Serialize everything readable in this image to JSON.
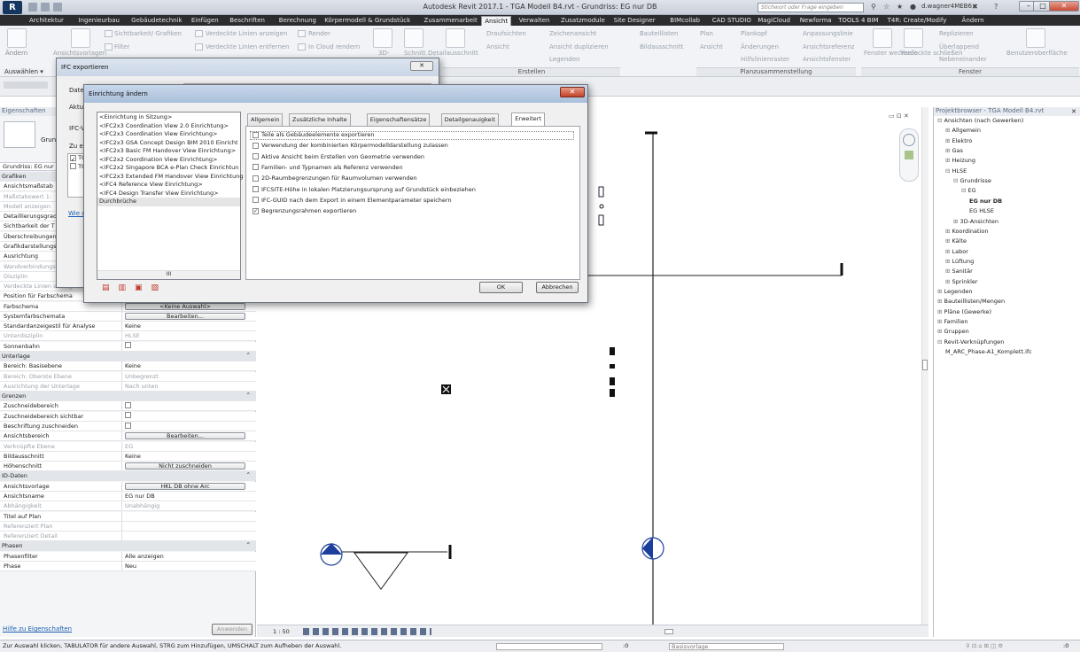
{
  "window": {
    "title": "Autodesk Revit 2017.1 -   TGA Modell B4.rvt - Grundriss: EG nur DB",
    "search_placeholder": "Stichwort oder Frage eingeben",
    "user": "d.wagner4MEB6"
  },
  "menu": {
    "tabs": [
      "Architektur",
      "Ingenieurbau",
      "Gebäudetechnik",
      "Einfügen",
      "Beschriften",
      "Berechnung",
      "Körpermodell & Grundstück",
      "Zusammenarbeit",
      "Ansicht",
      "Verwalten",
      "Zusatzmodule",
      "Site Designer",
      "BIMcollab",
      "CAD STUDIO",
      "MagiCloud",
      "Newforma",
      "TOOLS 4 BIM",
      "T4R: Create/Modify",
      "Ändern"
    ],
    "active": "Ansicht"
  },
  "ribbon": {
    "items": [
      "Sichtbarkeit/ Grafiken",
      "Verdeckte Linien anzeigen",
      "Render",
      "Draufsichten",
      "Zeichenansicht",
      "Bauteillisten",
      "Plan",
      "Plankopf",
      "Anpassungslinie",
      "Filter",
      "Verdeckte Linien entfernen",
      "In Cloud  rendern",
      "Ansicht",
      "Ansicht duplizieren",
      "Bildausschnitt",
      "Ansicht",
      "Änderungen",
      "Ansichtsreferenz",
      "Replizieren",
      "Überlappend",
      "Benutzeroberfläche",
      "Legenden",
      "Hilfslinienraster",
      "Ansichtsfenster",
      "Fenster wechseln",
      "Verdeckte schließen",
      "Nebeneinander",
      "Ändern",
      "Ansichtsvorlagen",
      "3D-",
      "Schnitt",
      "Detailausschnitt"
    ],
    "panels": [
      "Erstellen",
      "Planzusammenstellung",
      "Fenster"
    ]
  },
  "optionsbar": {
    "select_label": "Auswählen ▾"
  },
  "properties": {
    "header": "Eigenschaften",
    "type_label": "Grundriss",
    "instance_label": "Grundriss: EG nur",
    "rows": [
      {
        "kind": "group",
        "label": "Grafiken"
      },
      {
        "label": "Ansichtsmaßstab",
        "value": ""
      },
      {
        "label": "Maßstabswert 1:",
        "value": "",
        "grey": true
      },
      {
        "label": "Modell anzeigen",
        "value": "",
        "grey": true
      },
      {
        "label": "Detaillierungsgrad",
        "value": ""
      },
      {
        "label": "Sichtbarkeit der T",
        "value": ""
      },
      {
        "label": "Überschreibungen",
        "value": ""
      },
      {
        "label": "Grafikdarstellungsoptionen",
        "value": ""
      },
      {
        "label": "Ausrichtung",
        "value": ""
      },
      {
        "label": "Wandverbindungsanzeige",
        "value": "",
        "grey": true
      },
      {
        "label": "Disziplin",
        "value": "",
        "grey": true
      },
      {
        "label": "Verdeckte Linien anzeigen",
        "value": "",
        "grey": true
      },
      {
        "label": "Position für Farbschema",
        "value": ""
      },
      {
        "label": "Farbschema",
        "button": "<Keine Auswahl>"
      },
      {
        "label": "Systemfarbschemata",
        "button": "Bearbeiten..."
      },
      {
        "label": "Standardanzeigestil für Analyse",
        "value": "Keine"
      },
      {
        "label": "Unterdisziplin",
        "value": "HLSE",
        "grey": true
      },
      {
        "label": "Sonnenbahn",
        "check": true
      },
      {
        "kind": "group",
        "label": "Unterlage"
      },
      {
        "label": "Bereich: Basisebene",
        "value": "Keine"
      },
      {
        "label": "Bereich: Oberste Ebene",
        "value": "Unbegrenzt",
        "grey": true
      },
      {
        "label": "Ausrichtung der Unterlage",
        "value": "Nach unten",
        "grey": true
      },
      {
        "kind": "group",
        "label": "Grenzen"
      },
      {
        "label": "Zuschneidebereich",
        "check": true
      },
      {
        "label": "Zuschneidebereich sichtbar",
        "check": true
      },
      {
        "label": "Beschriftung zuschneiden",
        "check": true
      },
      {
        "label": "Ansichtsbereich",
        "button": "Bearbeiten..."
      },
      {
        "label": "Verknüpfte Ebene",
        "value": "EG",
        "grey": true
      },
      {
        "label": "Bildausschnitt",
        "value": "Keine"
      },
      {
        "label": "Höhenschnitt",
        "button": "Nicht zuschneiden"
      },
      {
        "kind": "group",
        "label": "ID-Daten"
      },
      {
        "label": "Ansichtsvorlage",
        "button": "HKL DB ohne Arc"
      },
      {
        "label": "Ansichtsname",
        "value": "EG nur DB"
      },
      {
        "label": "Abhängigkeit",
        "value": "Unabhängig",
        "grey": true
      },
      {
        "label": "Titel auf Plan",
        "value": ""
      },
      {
        "label": "Referenziert Plan",
        "value": "",
        "grey": true
      },
      {
        "label": "Referenziert Detail",
        "value": "",
        "grey": true
      },
      {
        "kind": "group",
        "label": "Phasen"
      },
      {
        "label": "Phasenfilter",
        "value": "Alle anzeigen"
      },
      {
        "label": "Phase",
        "value": "Neu"
      }
    ],
    "help_link": "Hilfe zu Eigenschaften",
    "apply_button": "Anwenden"
  },
  "viewbar": {
    "scale": "1 : 50"
  },
  "browser": {
    "header": "Projektbrowser - TGA Modell B4.rvt",
    "nodes": [
      {
        "label": "Ansichten (nach Gewerken)",
        "depth": 0,
        "tog": "⊟"
      },
      {
        "label": "Allgemein",
        "depth": 1,
        "tog": "⊞"
      },
      {
        "label": "Elektro",
        "depth": 1,
        "tog": "⊞"
      },
      {
        "label": "Gas",
        "depth": 1,
        "tog": "⊞"
      },
      {
        "label": "Heizung",
        "depth": 1,
        "tog": "⊞"
      },
      {
        "label": "HLSE",
        "depth": 1,
        "tog": "⊟"
      },
      {
        "label": "Grundrisse",
        "depth": 2,
        "tog": "⊟"
      },
      {
        "label": "EG",
        "depth": 3,
        "tog": "⊟"
      },
      {
        "label": "EG nur DB",
        "depth": 4,
        "tog": "",
        "sel": true
      },
      {
        "label": "EG HLSE",
        "depth": 4,
        "tog": ""
      },
      {
        "label": "3D-Ansichten",
        "depth": 2,
        "tog": "⊞"
      },
      {
        "label": "Koordination",
        "depth": 1,
        "tog": "⊞"
      },
      {
        "label": "Kälte",
        "depth": 1,
        "tog": "⊞"
      },
      {
        "label": "Labor",
        "depth": 1,
        "tog": "⊞"
      },
      {
        "label": "Lüftung",
        "depth": 1,
        "tog": "⊞"
      },
      {
        "label": "Sanitär",
        "depth": 1,
        "tog": "⊞"
      },
      {
        "label": "Sprinkler",
        "depth": 1,
        "tog": "⊞"
      },
      {
        "label": "Legenden",
        "depth": 0,
        "tog": "⊞"
      },
      {
        "label": "Bauteillisten/Mengen",
        "depth": 0,
        "tog": "⊞"
      },
      {
        "label": "Pläne (Gewerke)",
        "depth": 0,
        "tog": "⊞"
      },
      {
        "label": "Familien",
        "depth": 0,
        "tog": "⊞"
      },
      {
        "label": "Gruppen",
        "depth": 0,
        "tog": "⊞"
      },
      {
        "label": "Revit-Verknüpfungen",
        "depth": 0,
        "tog": "⊟"
      },
      {
        "label": "M_ARC_Phase-A1_Komplett.ifc",
        "depth": 1,
        "tog": ""
      }
    ]
  },
  "status": {
    "text": "Zur Auswahl klicken, TABULATOR für andere Auswahl, STRG zum Hinzufügen, UMSCHALT zum Aufheben der Auswahl.",
    "zero": ":0",
    "base": "Basisvorlage",
    "filter": ":0"
  },
  "ifc_dialog": {
    "title": "IFC exportieren",
    "labels": [
      "Datei",
      "Aktue",
      "IFC-V",
      "Zu ex"
    ],
    "list": [
      "TG",
      "TG"
    ],
    "link": "Wie gi"
  },
  "setup_dialog": {
    "title": "Einrichtung ändern",
    "setups": [
      "<Einrichtung in Sitzung>",
      "<IFC2x3 Coordination View 2.0 Einrichtung>",
      "<IFC2x3 Coordination View Einrichtung>",
      "<IFC2x3 GSA Concept Design BIM 2010 Einricht",
      "<IFC2x3 Basic FM Handover View Einrichtung>",
      "<IFC2x2 Coordination View Einrichtung>",
      "<IFC2x2 Singapore BCA e-Plan Check Einrichtun",
      "<IFC2x3 Extended FM Handover View Einrichtung",
      "<IFC4 Reference View Einrichtung>",
      "<IFC4 Design Transfer View Einrichtung>",
      "Durchbrüche"
    ],
    "tabs": [
      "Allgemein",
      "Zusätzliche Inhalte",
      "Eigenschaftensätze",
      "Detailgenauigkeit",
      "Erweitert"
    ],
    "active_tab": "Erweitert",
    "options": [
      {
        "label": "Teile als Gebäudeelemente exportieren",
        "checked": false
      },
      {
        "label": "Verwendung der kombinierten Körpermodelldarstellung zulassen",
        "checked": false
      },
      {
        "label": "Aktive Ansicht beim Erstellen von Geometrie verwenden",
        "checked": false
      },
      {
        "label": "Familien- und Typnamen als Referenz verwenden",
        "checked": false
      },
      {
        "label": "2D-Raumbegrenzungen für Raumvolumen verwenden",
        "checked": false
      },
      {
        "label": "IFCSITE-Höhe in lokalen Platzierungsursprung auf Grundstück einbeziehen",
        "checked": false
      },
      {
        "label": "IFC-GUID nach dem Export in einem Elementparameter speichern",
        "checked": false
      },
      {
        "label": "Begrenzungsrahmen exportieren",
        "checked": true
      }
    ],
    "ok": "OK",
    "cancel": "Abbrechen",
    "scroll_mark": "III"
  }
}
